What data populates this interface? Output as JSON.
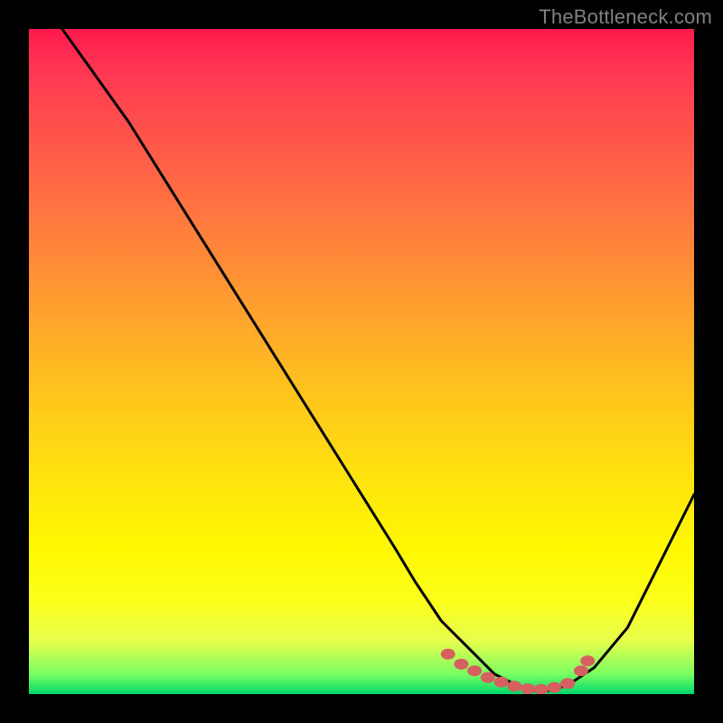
{
  "attribution": "TheBottleneck.com",
  "colors": {
    "background": "#000000",
    "gradient_top": "#ff1a4d",
    "gradient_bottom": "#00d86c",
    "curve": "#000000",
    "markers": "#d66060"
  },
  "chart_data": {
    "type": "line",
    "title": "",
    "xlabel": "",
    "ylabel": "",
    "xlim": [
      0,
      100
    ],
    "ylim": [
      0,
      100
    ],
    "series": [
      {
        "name": "curve",
        "x": [
          5,
          10,
          15,
          20,
          25,
          30,
          35,
          40,
          45,
          50,
          55,
          58,
          60,
          62,
          65,
          68,
          70,
          72,
          74,
          76,
          78,
          80,
          82,
          85,
          90,
          95,
          100
        ],
        "y": [
          100,
          93,
          86,
          78,
          70,
          62,
          54,
          46,
          38,
          30,
          22,
          17,
          14,
          11,
          8,
          5,
          3,
          2,
          1,
          0.5,
          0.5,
          1,
          2,
          4,
          10,
          20,
          30
        ]
      }
    ],
    "markers": [
      {
        "x": 63,
        "y": 6
      },
      {
        "x": 65,
        "y": 4.5
      },
      {
        "x": 67,
        "y": 3.5
      },
      {
        "x": 69,
        "y": 2.5
      },
      {
        "x": 71,
        "y": 1.8
      },
      {
        "x": 73,
        "y": 1.2
      },
      {
        "x": 75,
        "y": 0.8
      },
      {
        "x": 77,
        "y": 0.7
      },
      {
        "x": 79,
        "y": 1.0
      },
      {
        "x": 81,
        "y": 1.6
      },
      {
        "x": 83,
        "y": 3.5
      },
      {
        "x": 84,
        "y": 5
      }
    ]
  }
}
